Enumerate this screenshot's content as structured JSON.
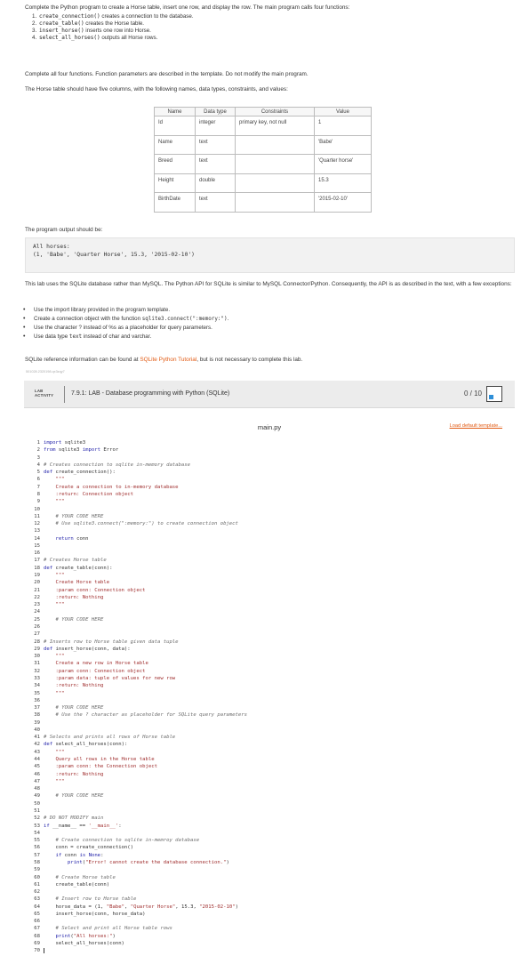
{
  "intro": {
    "line1": "Complete the Python program to create a Horse table, insert one row, and display the row. The main program calls four functions:",
    "functions": [
      {
        "num": "1.",
        "code": "create_connection()",
        "desc": " creates a connection to the database."
      },
      {
        "num": "2.",
        "code": "create_table()",
        "desc": " creates the Horse table."
      },
      {
        "num": "3.",
        "code": "insert_horse()",
        "desc": " inserts one row into Horse."
      },
      {
        "num": "4.",
        "code": "select_all_horses()",
        "desc": " outputs all Horse rows."
      }
    ],
    "line2": "Complete all four functions. Function parameters are described in the template. Do not modify the main program.",
    "line3": "The Horse table should have five columns, with the following names, data types, constraints, and values:"
  },
  "spec_table": {
    "headers": [
      "Name",
      "Data type",
      "Constraints",
      "Value"
    ],
    "rows": [
      [
        "Id",
        "integer",
        "primary key, not null",
        "1"
      ],
      [
        "Name",
        "text",
        "",
        "'Babe'"
      ],
      [
        "Breed",
        "text",
        "",
        "'Quarter horse'"
      ],
      [
        "Height",
        "double",
        "",
        "15.3"
      ],
      [
        "BirthDate",
        "text",
        "",
        "'2015-02-10'"
      ]
    ]
  },
  "output": {
    "label": "The program output should be:",
    "line1": "All horses:",
    "line2": "(1, 'Babe', 'Quarter Horse', 15.3, '2015-02-10')"
  },
  "notes": {
    "api_text": "This lab uses the SQLite database rather than MySQL. The Python API for SQLite is similar to MySQL Connector/Python. Consequently, the API is as described in the text, with a few exceptions:",
    "exceptions": [
      {
        "before": "Use the import library provided in the program template.",
        "code": "",
        "after": ""
      },
      {
        "before": "Create a connection object with the function ",
        "code": "sqlite3.connect(\":memory:\")",
        "after": "."
      },
      {
        "before": "Use the character ? instead of %s as a placeholder for query parameters.",
        "code": "",
        "after": ""
      },
      {
        "before": "Use data type ",
        "code": "text",
        "after": " instead of char and varchar."
      }
    ],
    "ref_before": "SQLite reference information can be found at ",
    "ref_link": "SQLite Python Tutorial",
    "ref_after": ", but is not necessary to complete this lab.",
    "tiny_id": "501028.2320198.qx3zqy7"
  },
  "lab": {
    "badge_line1": "LAB",
    "badge_line2": "ACTIVITY",
    "title": "7.9.1: LAB - Database programming with Python (SQLite)",
    "score": "0 / 10"
  },
  "editor": {
    "file_name": "main.py",
    "load_template": "Load default template...",
    "lines": [
      "import sqlite3",
      "from sqlite3 import Error",
      "",
      "# Creates connection to sqlite in-memory database",
      "def create_connection():",
      "    \"\"\"",
      "    Create a connection to in-memory database",
      "    :return: Connection object",
      "    \"\"\"",
      "",
      "    # YOUR CODE HERE",
      "    # Use sqlite3.connect(\":memory:\") to create connection object",
      "",
      "    return conn",
      "",
      "",
      "# Creates Horse table",
      "def create_table(conn):",
      "    \"\"\"",
      "    Create Horse table",
      "    :param conn: Connection object",
      "    :return: Nothing",
      "    \"\"\"",
      "",
      "    # YOUR CODE HERE",
      "",
      "",
      "# Inserts row to Horse table given data tuple",
      "def insert_horse(conn, data):",
      "    \"\"\"",
      "    Create a new row in Horse table",
      "    :param conn: Connection object",
      "    :param data: tuple of values for new row",
      "    :return: Nothing",
      "    \"\"\"",
      "",
      "    # YOUR CODE HERE",
      "    # Use the ? character as placeholder for SQLite query parameters",
      "",
      "",
      "# Selects and prints all rows of Horse table",
      "def select_all_horses(conn):",
      "    \"\"\"",
      "    Query all rows in the Horse table",
      "    :param conn: the Connection object",
      "    :return: Nothing",
      "    \"\"\"",
      "",
      "    # YOUR CODE HERE",
      "",
      "",
      "# DO NOT MODIFY main",
      "if __name__ == '__main__':",
      "",
      "    # Create connection to sqlite in-memroy database",
      "    conn = create_connection()",
      "    if conn is None:",
      "        print(\"Error! cannot create the database connection.\")",
      "",
      "    # Create Horse table",
      "    create_table(conn)",
      "",
      "    # Insert row to Horse table",
      "    horse_data = (1, \"Babe\", \"Quarter Horse\", 15.3, \"2015-02-10\")",
      "    insert_horse(conn, horse_data)",
      "",
      "    # Select and print all Horse table rows",
      "    print(\"All horses:\")",
      "    select_all_horses(conn)",
      ""
    ]
  }
}
